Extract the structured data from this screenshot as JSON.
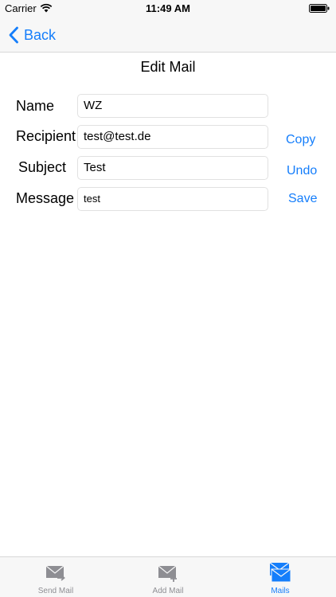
{
  "status_bar": {
    "carrier": "Carrier",
    "time": "11:49 AM"
  },
  "nav": {
    "back_label": "Back"
  },
  "page": {
    "title": "Edit Mail"
  },
  "form": {
    "name_label": "Name",
    "name_value": "WZ",
    "recipient_label": "Recipient",
    "recipient_value": "test@test.de",
    "subject_label": "Subject",
    "subject_value": "Test",
    "message_label": "Message",
    "message_value": "test"
  },
  "actions": {
    "copy_label": "Copy",
    "undo_label": "Undo",
    "save_label": "Save"
  },
  "tab_bar": {
    "tabs": [
      {
        "label": "Send Mail",
        "icon": "send-mail-icon",
        "active": false
      },
      {
        "label": "Add Mail",
        "icon": "add-mail-icon",
        "active": false
      },
      {
        "label": "Mails",
        "icon": "mails-icon",
        "active": true
      }
    ]
  },
  "colors": {
    "accent": "#157efb",
    "inactive": "#8e8e93",
    "bar_background": "#f7f7f7"
  }
}
